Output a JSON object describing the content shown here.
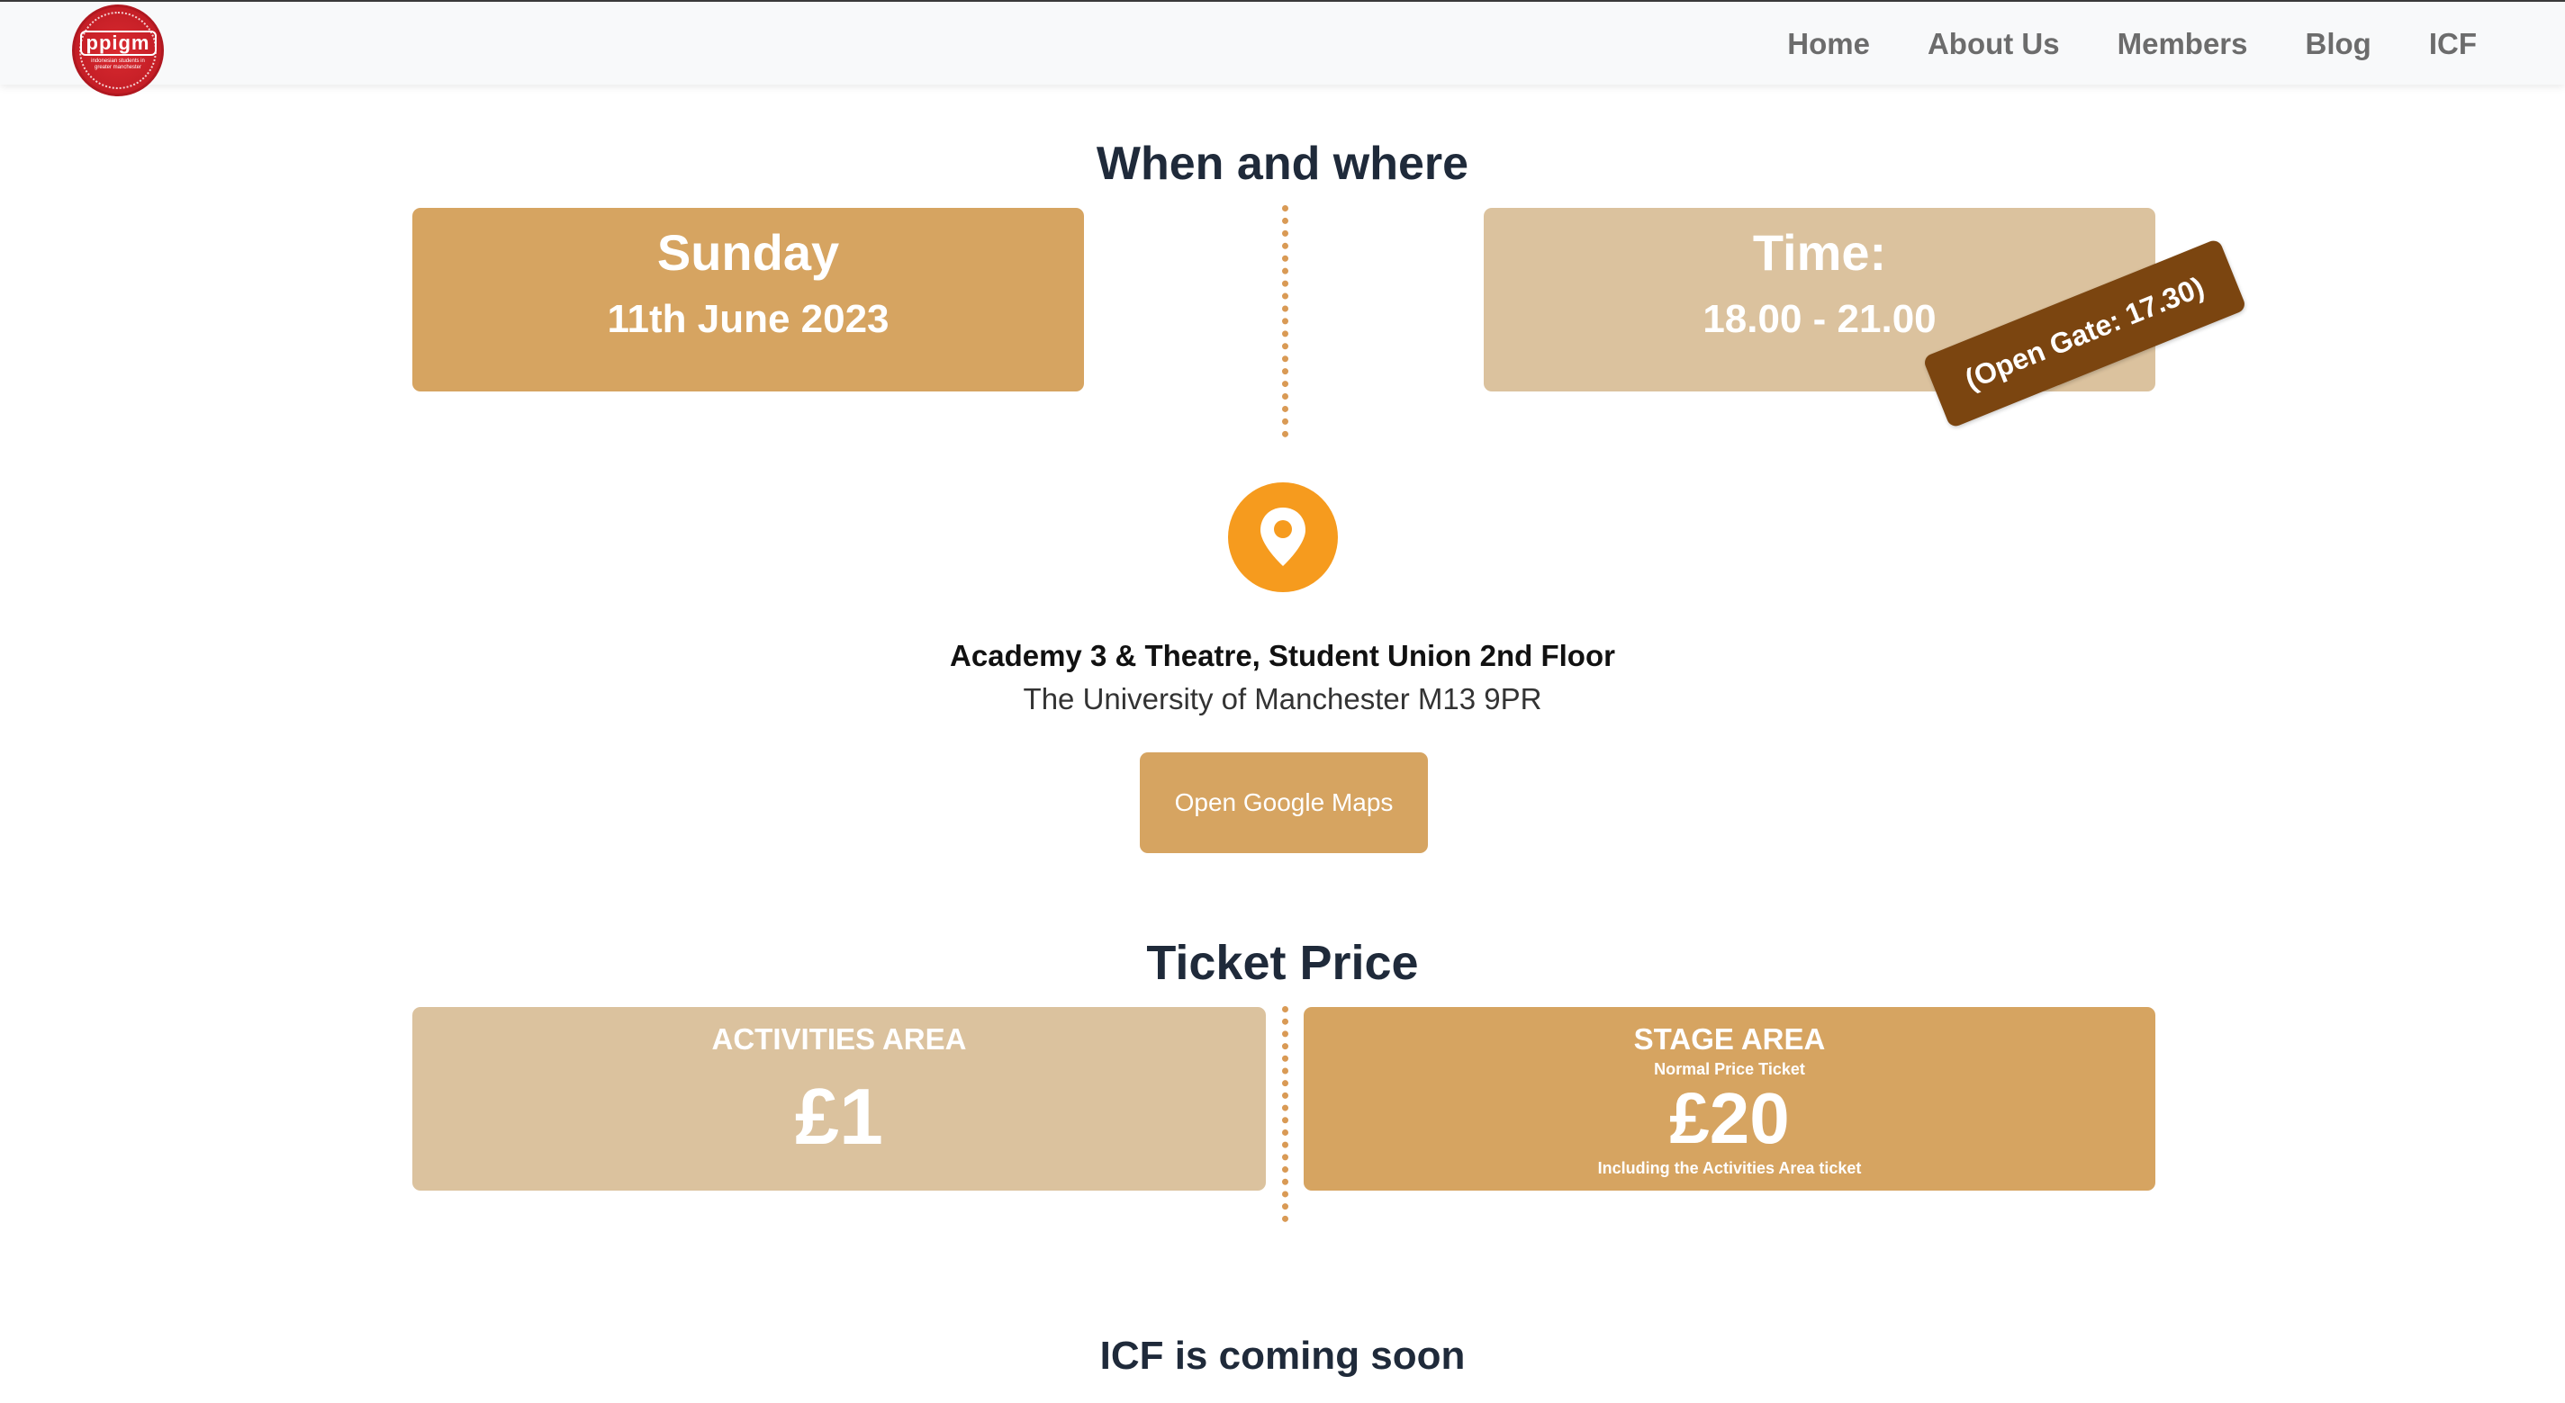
{
  "nav": {
    "logo_text": "ppigm",
    "logo_tagline": "indonesian students in greater manchester",
    "links": [
      "Home",
      "About Us",
      "Members",
      "Blog",
      "ICF"
    ]
  },
  "when_where": {
    "title": "When and where",
    "date": {
      "day": "Sunday",
      "date": "11th June 2023"
    },
    "time": {
      "label": "Time:",
      "value": "18.00 - 21.00",
      "open_gate": "(Open Gate: 17.30)"
    }
  },
  "location": {
    "icon": "map-pin-icon",
    "venue": "Academy 3 & Theatre, Student Union 2nd Floor",
    "address": "The University of Manchester M13 9PR",
    "maps_button": "Open Google Maps"
  },
  "tickets": {
    "title": "Ticket Price",
    "activities": {
      "label": "ACTIVITIES AREA",
      "price": "£1"
    },
    "stage": {
      "label": "STAGE AREA",
      "subtitle": "Normal Price Ticket",
      "price": "£20",
      "note": "Including the Activities Area ticket"
    }
  },
  "footer_heading": "ICF is coming soon",
  "colors": {
    "accent_dark": "#d6a461",
    "accent_light": "#dbc29e",
    "badge": "#7b4510",
    "pin": "#f69b1e",
    "logo_red": "#c41e26"
  }
}
